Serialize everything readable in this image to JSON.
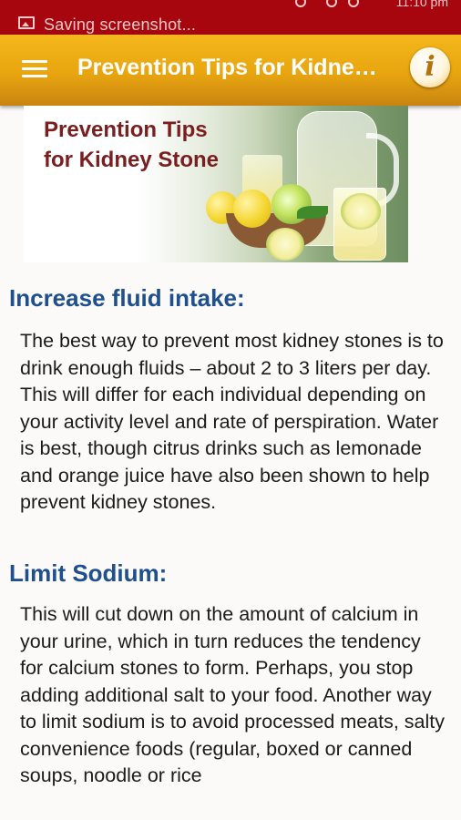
{
  "status_bar": {
    "notification_text": "Saving screenshot...",
    "clock": "11:10 pm"
  },
  "app_bar": {
    "title": "Prevention Tips for Kidney Stone",
    "menu_icon": "hamburger-menu-icon",
    "info_icon": "info-icon",
    "info_glyph": "i"
  },
  "banner": {
    "line1": "Prevention Tips",
    "line2": "for Kidney Stone"
  },
  "sections": [
    {
      "heading": "Increase fluid intake:",
      "body": "The best way to prevent most kidney stones is to drink enough fluids – about 2 to 3 liters per day. This will differ for each individual depending on your activity level and rate of perspiration. Water is best, though citrus drinks such as lemonade and orange juice have also been shown to help prevent kidney stones."
    },
    {
      "heading": "Limit Sodium:",
      "body": "This will cut down on the amount of calcium in your urine, which in turn reduces the tendency for calcium stones to form. Perhaps, you stop adding additional salt to your food. Another way to limit sodium is to avoid processed meats, salty convenience foods (regular, boxed or canned soups, noodle or rice"
    }
  ],
  "colors": {
    "status_bar": "#a8060e",
    "app_bar": "#e8a50f",
    "heading": "#1e4f8e",
    "banner_text": "#7a1e1f"
  }
}
